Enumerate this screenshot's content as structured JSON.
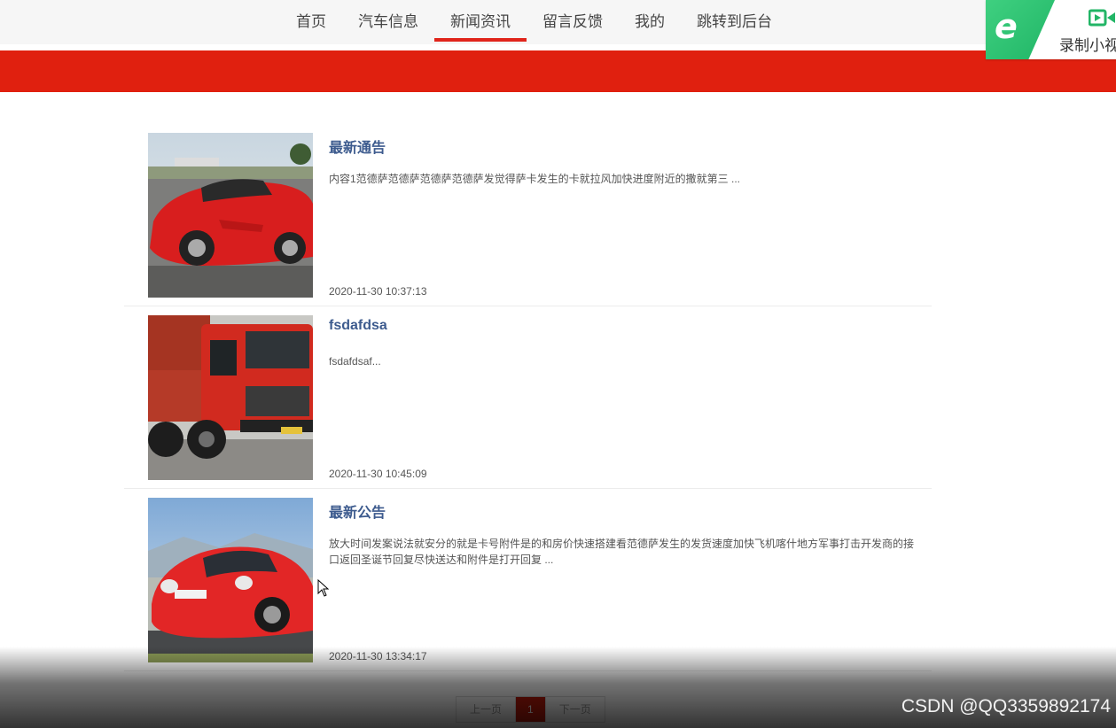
{
  "nav": {
    "items": [
      {
        "label": "首页"
      },
      {
        "label": "汽车信息"
      },
      {
        "label": "新闻资讯",
        "active": true
      },
      {
        "label": "留言反馈"
      },
      {
        "label": "我的"
      },
      {
        "label": "跳转到后台"
      }
    ]
  },
  "recorder": {
    "label": "录制小视",
    "icon": "e-browser-icon"
  },
  "news": [
    {
      "title": "最新通告",
      "summary": "内容1范德萨范德萨范德萨范德萨发觉得萨卡发生的卡就拉风加快进度附近的撒就第三 ...",
      "date": "2020-11-30 10:37:13",
      "image": "red-sports-car"
    },
    {
      "title": "fsdafdsa",
      "summary": "fsdafdsaf...",
      "date": "2020-11-30 10:45:09",
      "image": "red-dump-truck"
    },
    {
      "title": "最新公告",
      "summary": "放大时间发案说法就安分的就是卡号附件是的和房价快速搭建看范德萨发生的发货速度加快飞机喀什地方军事打击开发商的接口返回圣诞节回复尽快送达和附件是打开回复 ...",
      "date": "2020-11-30 13:34:17",
      "image": "red-porsche"
    }
  ],
  "pager": {
    "prev": "上一页",
    "current": "1",
    "next": "下一页"
  },
  "watermark": "CSDN @QQ3359892174",
  "colors": {
    "accent": "#e0200f",
    "title": "#3d5b8e",
    "pager_active": "#c31a0a"
  }
}
